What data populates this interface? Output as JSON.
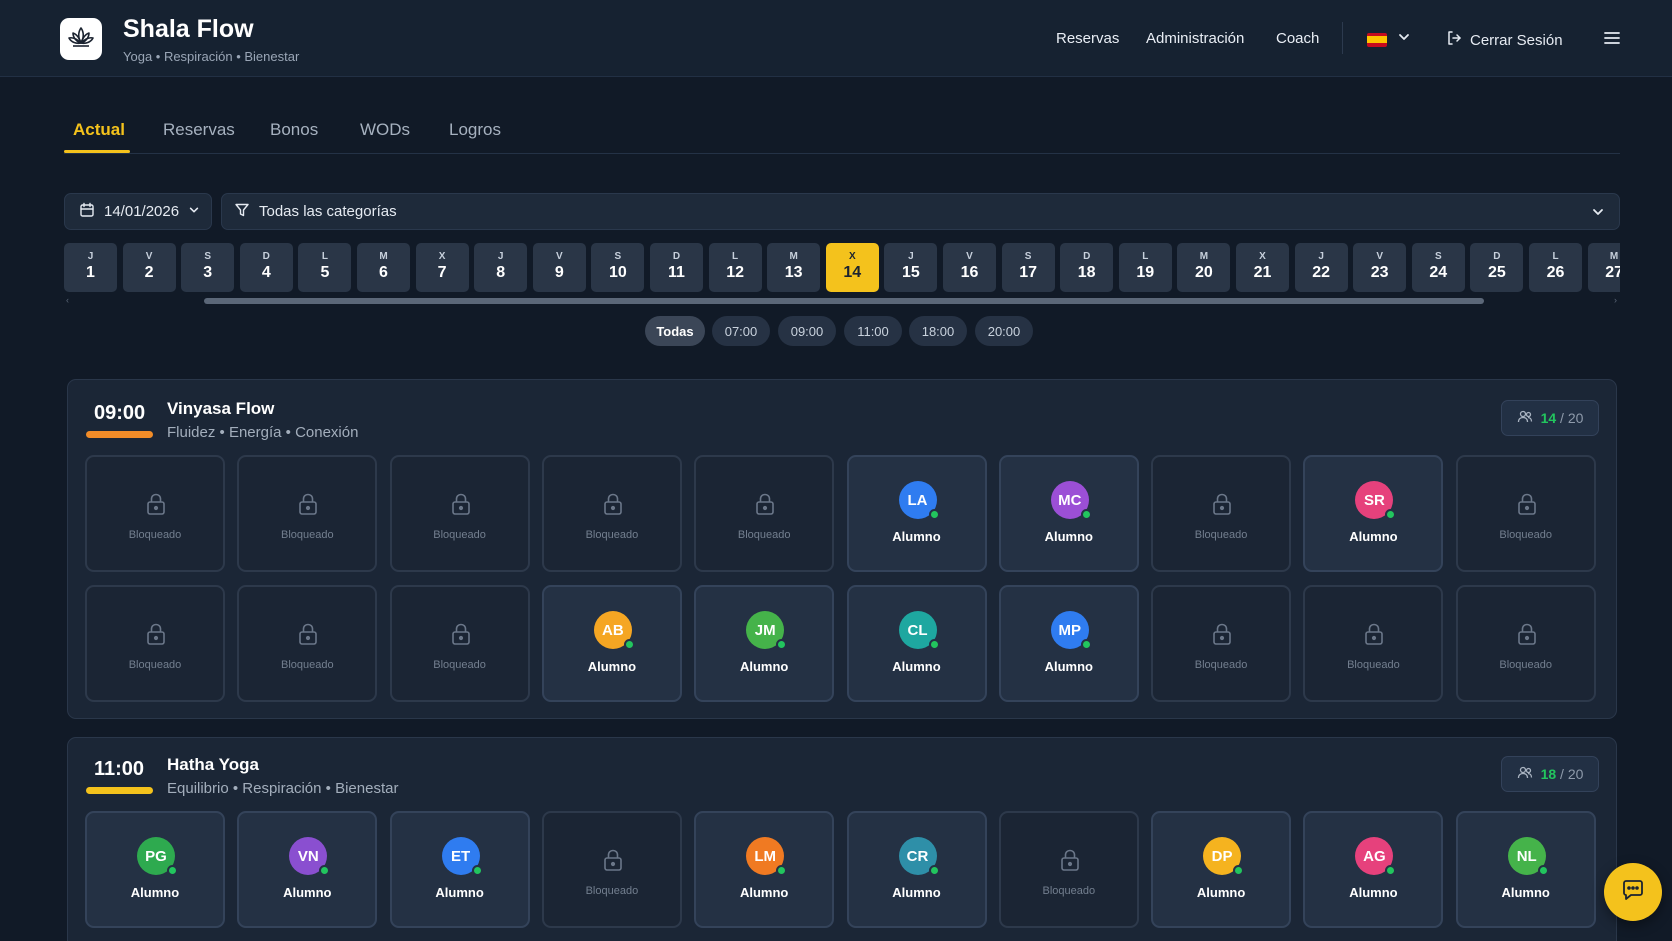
{
  "app": {
    "title": "Shala Flow",
    "subtitle": "Yoga • Respiración • Bienestar",
    "logo_icon": "lotus-icon"
  },
  "nav": {
    "links": [
      "Reservas",
      "Administración",
      "Coach"
    ],
    "language": "es",
    "logout_label": "Cerrar Sesión"
  },
  "tabs": [
    "Actual",
    "Reservas",
    "Bonos",
    "WODs",
    "Logros"
  ],
  "active_tab": "Actual",
  "filters": {
    "date": "14/01/2026",
    "category": "Todas las categorías"
  },
  "days": [
    {
      "l": "J",
      "n": "1"
    },
    {
      "l": "V",
      "n": "2"
    },
    {
      "l": "S",
      "n": "3"
    },
    {
      "l": "D",
      "n": "4"
    },
    {
      "l": "L",
      "n": "5"
    },
    {
      "l": "M",
      "n": "6"
    },
    {
      "l": "X",
      "n": "7"
    },
    {
      "l": "J",
      "n": "8"
    },
    {
      "l": "V",
      "n": "9"
    },
    {
      "l": "S",
      "n": "10"
    },
    {
      "l": "D",
      "n": "11"
    },
    {
      "l": "L",
      "n": "12"
    },
    {
      "l": "M",
      "n": "13"
    },
    {
      "l": "X",
      "n": "14"
    },
    {
      "l": "J",
      "n": "15"
    },
    {
      "l": "V",
      "n": "16"
    },
    {
      "l": "S",
      "n": "17"
    },
    {
      "l": "D",
      "n": "18"
    },
    {
      "l": "L",
      "n": "19"
    },
    {
      "l": "M",
      "n": "20"
    },
    {
      "l": "X",
      "n": "21"
    },
    {
      "l": "J",
      "n": "22"
    },
    {
      "l": "V",
      "n": "23"
    },
    {
      "l": "S",
      "n": "24"
    },
    {
      "l": "D",
      "n": "25"
    },
    {
      "l": "L",
      "n": "26"
    },
    {
      "l": "M",
      "n": "27"
    }
  ],
  "selected_day": "14",
  "scroll_arrows": {
    "left": "‹",
    "right": "›"
  },
  "time_chips": [
    "Todas",
    "07:00",
    "09:00",
    "11:00",
    "18:00",
    "20:00"
  ],
  "active_chip": "Todas",
  "classes": [
    {
      "time": "09:00",
      "name": "Vinyasa Flow",
      "tags": "Fluidez • Energía • Conexión",
      "bar_color": "#f28c28",
      "capacity": {
        "count": "14",
        "sep": "/",
        "total": "20"
      },
      "slots": [
        {
          "state": "locked",
          "label": "Bloqueado"
        },
        {
          "state": "locked",
          "label": "Bloqueado"
        },
        {
          "state": "locked",
          "label": "Bloqueado"
        },
        {
          "state": "locked",
          "label": "Bloqueado"
        },
        {
          "state": "locked",
          "label": "Bloqueado"
        },
        {
          "state": "taken",
          "initials": "LA",
          "color": "#2f7cf0",
          "label": "Alumno"
        },
        {
          "state": "taken",
          "initials": "MC",
          "color": "#9b4fd6",
          "label": "Alumno"
        },
        {
          "state": "locked",
          "label": "Bloqueado"
        },
        {
          "state": "taken",
          "initials": "SR",
          "color": "#e6417c",
          "label": "Alumno"
        },
        {
          "state": "locked",
          "label": "Bloqueado"
        },
        {
          "state": "locked",
          "label": "Bloqueado"
        },
        {
          "state": "locked",
          "label": "Bloqueado"
        },
        {
          "state": "locked",
          "label": "Bloqueado"
        },
        {
          "state": "taken",
          "initials": "AB",
          "color": "#f5a623",
          "label": "Alumno"
        },
        {
          "state": "taken",
          "initials": "JM",
          "color": "#45b34a",
          "label": "Alumno"
        },
        {
          "state": "taken",
          "initials": "CL",
          "color": "#1ea7a0",
          "label": "Alumno"
        },
        {
          "state": "taken",
          "initials": "MP",
          "color": "#2f7cf0",
          "label": "Alumno"
        },
        {
          "state": "locked",
          "label": "Bloqueado"
        },
        {
          "state": "locked",
          "label": "Bloqueado"
        },
        {
          "state": "locked",
          "label": "Bloqueado"
        }
      ]
    },
    {
      "time": "11:00",
      "name": "Hatha Yoga",
      "tags": "Equilibrio • Respiración • Bienestar",
      "bar_color": "#f4c21c",
      "capacity": {
        "count": "18",
        "sep": "/",
        "total": "20"
      },
      "slots": [
        {
          "state": "taken",
          "initials": "PG",
          "color": "#2eaa4f",
          "label": "Alumno"
        },
        {
          "state": "taken",
          "initials": "VN",
          "color": "#8a4fd0",
          "label": "Alumno"
        },
        {
          "state": "taken",
          "initials": "ET",
          "color": "#2f7cf0",
          "label": "Alumno"
        },
        {
          "state": "locked",
          "label": "Bloqueado"
        },
        {
          "state": "taken",
          "initials": "LM",
          "color": "#f07a22",
          "label": "Alumno"
        },
        {
          "state": "taken",
          "initials": "CR",
          "color": "#2e8fa8",
          "label": "Alumno"
        },
        {
          "state": "locked",
          "label": "Bloqueado"
        },
        {
          "state": "taken",
          "initials": "DP",
          "color": "#f5b31f",
          "label": "Alumno"
        },
        {
          "state": "taken",
          "initials": "AG",
          "color": "#e6417c",
          "label": "Alumno"
        },
        {
          "state": "taken",
          "initials": "NL",
          "color": "#45b34a",
          "label": "Alumno"
        }
      ]
    }
  ]
}
